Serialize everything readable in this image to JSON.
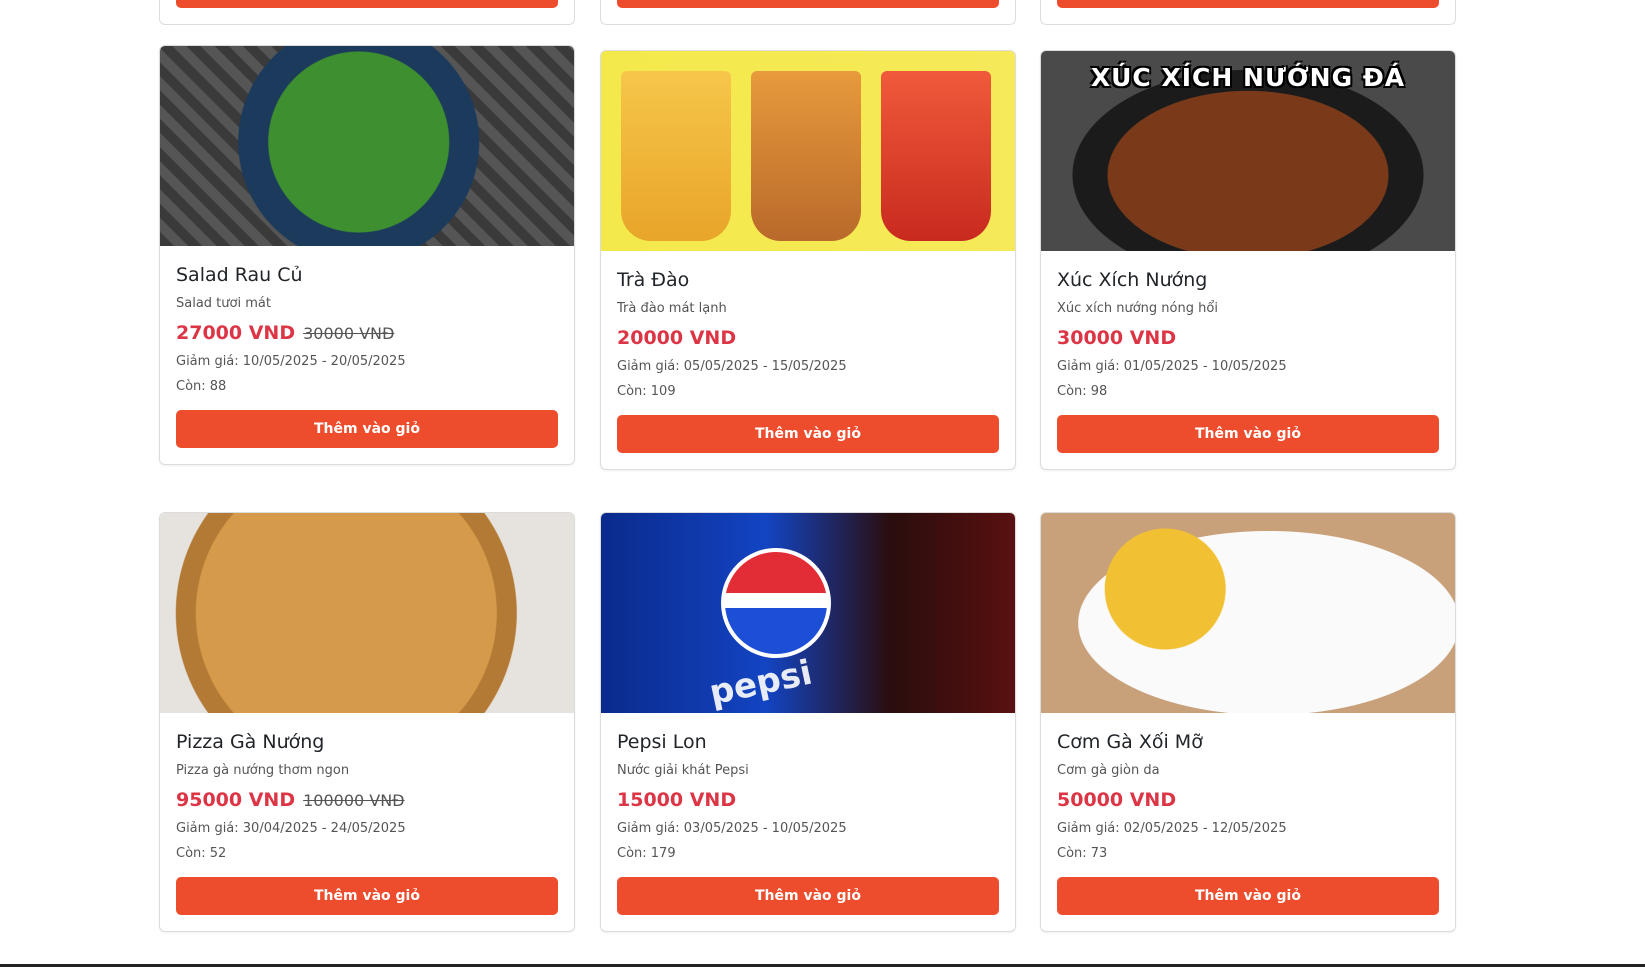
{
  "products": [
    {
      "name": "Salad Rau Củ",
      "desc": "Salad tươi mát",
      "price": "27000 VND",
      "old_price": "30000 VNĐ",
      "discount": "Giảm giá: 10/05/2025 - 20/05/2025",
      "stock": "Còn: 88",
      "button": "Thêm vào giỏ",
      "image": "salad-photo"
    },
    {
      "name": "Trà Đào",
      "desc": "Trà đào mát lạnh",
      "price": "20000 VND",
      "old_price": "",
      "discount": "Giảm giá: 05/05/2025 - 15/05/2025",
      "stock": "Còn: 109",
      "button": "Thêm vào giỏ",
      "image": "peach-tea-photo"
    },
    {
      "name": "Xúc Xích Nướng",
      "desc": "Xúc xích nướng nóng hổi",
      "price": "30000 VND",
      "old_price": "",
      "discount": "Giảm giá: 01/05/2025 - 10/05/2025",
      "stock": "Còn: 98",
      "button": "Thêm vào giỏ",
      "image": "grilled-sausage-photo",
      "image_text": "XÚC XÍCH NƯỚNG ĐÁ"
    },
    {
      "name": "Pizza Gà Nướng",
      "desc": "Pizza gà nướng thơm ngon",
      "price": "95000 VND",
      "old_price": "100000 VNĐ",
      "discount": "Giảm giá: 30/04/2025 - 24/05/2025",
      "stock": "Còn: 52",
      "button": "Thêm vào giỏ",
      "image": "pizza-photo"
    },
    {
      "name": "Pepsi Lon",
      "desc": "Nước giải khát Pepsi",
      "price": "15000 VND",
      "old_price": "",
      "discount": "Giảm giá: 03/05/2025 - 10/05/2025",
      "stock": "Còn: 179",
      "button": "Thêm vào giỏ",
      "image": "pepsi-photo",
      "image_text": "pepsi"
    },
    {
      "name": "Cơm Gà Xối Mỡ",
      "desc": "Cơm gà giòn da",
      "price": "50000 VND",
      "old_price": "",
      "discount": "Giảm giá: 02/05/2025 - 12/05/2025",
      "stock": "Còn: 73",
      "button": "Thêm vào giỏ",
      "image": "chicken-rice-photo"
    }
  ],
  "colors": {
    "accent": "#ee4d2d",
    "price": "#dc3545"
  }
}
